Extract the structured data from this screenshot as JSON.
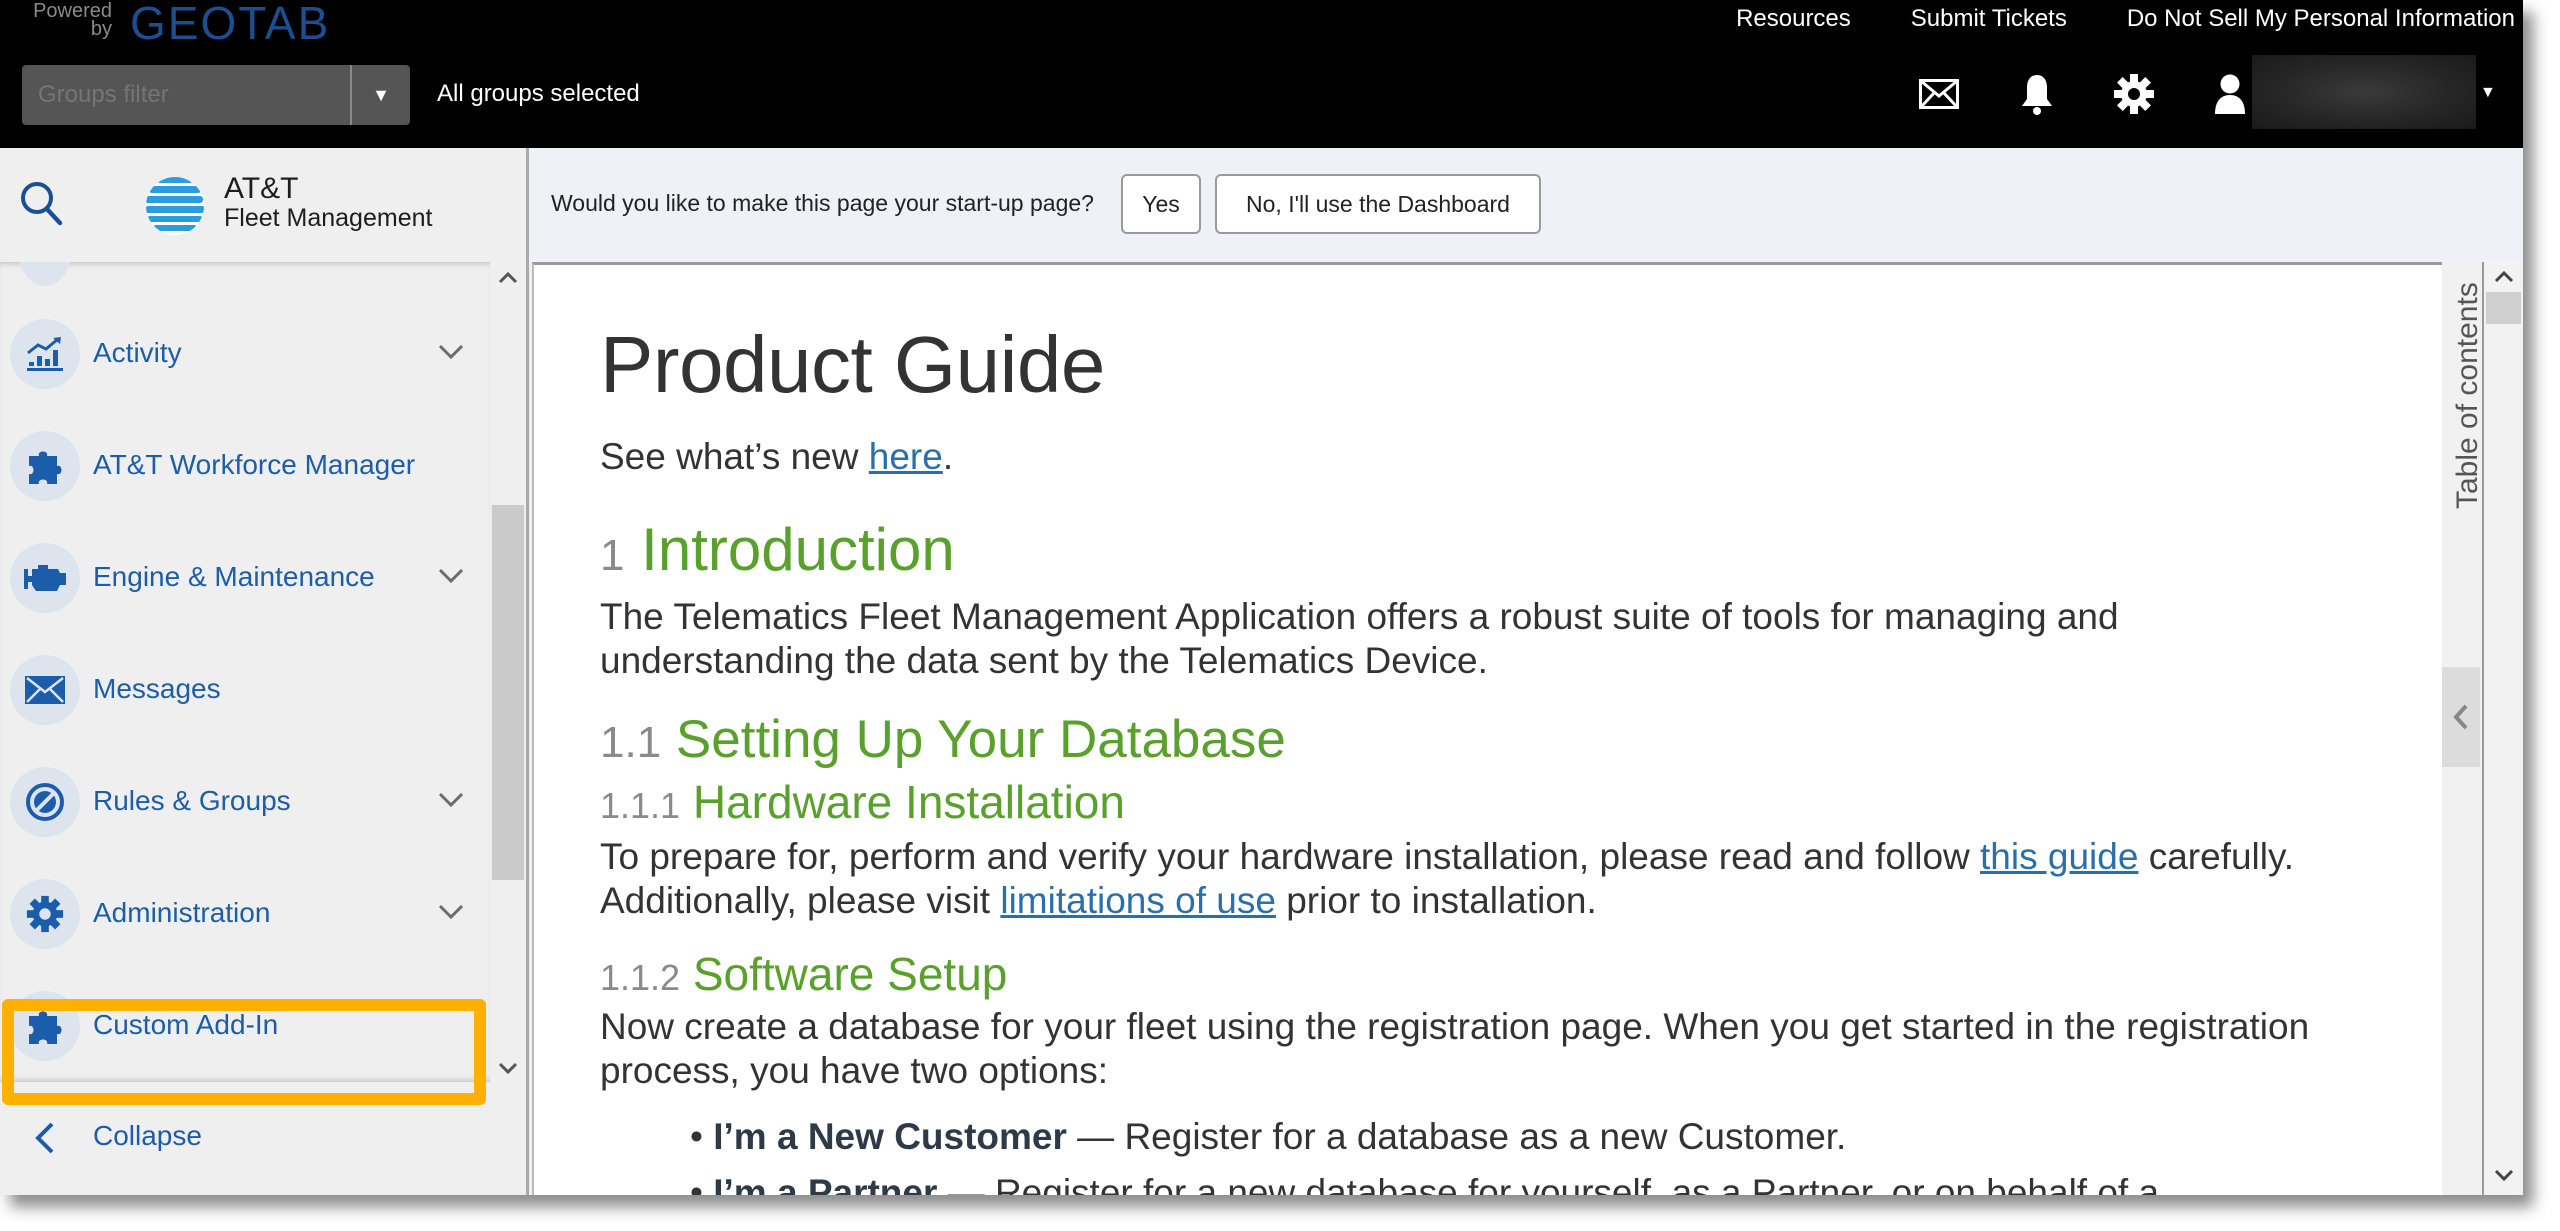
{
  "header": {
    "powered_by": "Powered by",
    "brand": "GEOTAB",
    "links": [
      "Resources",
      "Submit Tickets",
      "Do Not Sell My Personal Information"
    ],
    "groups_filter_placeholder": "Groups filter",
    "groups_status": "All groups selected",
    "icons": [
      "mail-icon",
      "bell-icon",
      "gear-icon",
      "user-icon"
    ]
  },
  "sidebar": {
    "logo_title": "AT&T",
    "logo_subtitle": "Fleet Management",
    "items": [
      {
        "label": "Activity",
        "icon": "activity-chart-icon",
        "expandable": true
      },
      {
        "label": "AT&T Workforce Manager",
        "icon": "puzzle-icon",
        "expandable": false
      },
      {
        "label": "Engine & Maintenance",
        "icon": "engine-icon",
        "expandable": true
      },
      {
        "label": "Messages",
        "icon": "envelope-icon",
        "expandable": false
      },
      {
        "label": "Rules & Groups",
        "icon": "rules-icon",
        "expandable": true
      },
      {
        "label": "Administration",
        "icon": "gear-icon",
        "expandable": true,
        "highlighted": true
      },
      {
        "label": "Custom Add-In",
        "icon": "puzzle-icon",
        "expandable": false
      }
    ],
    "collapse_label": "Collapse",
    "highlight_color": "#ffb000"
  },
  "startup": {
    "question": "Would you like to make this page your start-up page?",
    "yes_label": "Yes",
    "no_label": "No, I'll use the Dashboard"
  },
  "doc": {
    "title": "Product Guide",
    "whats_new_prefix": "See what’s new ",
    "whats_new_link": "here",
    "whats_new_suffix": ".",
    "sections": [
      {
        "num": "1",
        "title": "Introduction"
      },
      {
        "num": "1.1",
        "title": "Setting Up Your Database"
      },
      {
        "num": "1.1.1",
        "title": "Hardware Installation"
      },
      {
        "num": "1.1.2",
        "title": "Software Setup"
      }
    ],
    "intro_text": "The Telematics Fleet Management Application offers a robust suite of tools for managing and understanding the data sent by the Telematics Device.",
    "hw_text_1": "To prepare for, perform and verify your hardware installation, please read and follow ",
    "hw_link_1": "this guide",
    "hw_text_2": " carefully. Additionally, please visit ",
    "hw_link_2": "limitations of use",
    "hw_text_3": " prior to installation.",
    "sw_text": "Now create a database for your fleet using the registration page. When you get started in the registration process, you have two options:",
    "bullets": [
      {
        "bold": "I’m a New Customer",
        "text": " — Register for a database as a new Customer."
      },
      {
        "bold": "I’m a Partner",
        "text": " — Register for a new database for yourself, as a Partner, or on behalf of a"
      }
    ],
    "heading_color": "#5aa02c",
    "link_color": "#2a6faa"
  },
  "toc": {
    "label": "Table of contents"
  }
}
